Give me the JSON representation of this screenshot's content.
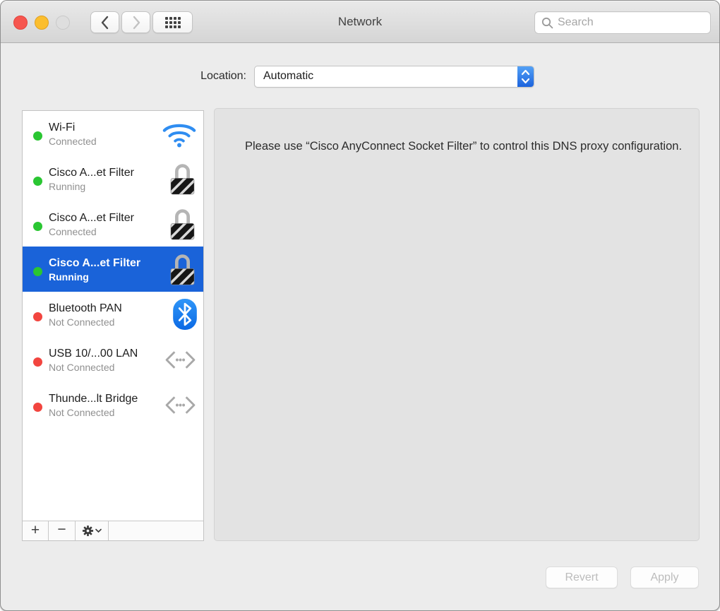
{
  "window": {
    "title": "Network",
    "search_placeholder": "Search"
  },
  "location": {
    "label": "Location:",
    "value": "Automatic"
  },
  "services": [
    {
      "name": "Wi-Fi",
      "status": "Connected",
      "dot": "green",
      "icon": "wifi-icon",
      "selected": false
    },
    {
      "name": "Cisco A...et Filter",
      "status": "Running",
      "dot": "green",
      "icon": "lock-icon",
      "selected": false
    },
    {
      "name": "Cisco A...et Filter",
      "status": "Connected",
      "dot": "green",
      "icon": "lock-icon",
      "selected": false
    },
    {
      "name": "Cisco A...et Filter",
      "status": "Running",
      "dot": "green",
      "icon": "lock-icon",
      "selected": true
    },
    {
      "name": "Bluetooth PAN",
      "status": "Not Connected",
      "dot": "red",
      "icon": "bluetooth-icon",
      "selected": false
    },
    {
      "name": "USB 10/...00 LAN",
      "status": "Not Connected",
      "dot": "red",
      "icon": "ethernet-icon",
      "selected": false
    },
    {
      "name": "Thunde...lt Bridge",
      "status": "Not Connected",
      "dot": "red",
      "icon": "ethernet-icon",
      "selected": false
    }
  ],
  "sidebar_actions": {
    "add_label": "+",
    "remove_label": "−"
  },
  "main_panel": {
    "message": "Please use “Cisco AnyConnect Socket Filter” to control this DNS proxy configuration."
  },
  "footer": {
    "revert_label": "Revert",
    "apply_label": "Apply"
  },
  "colors": {
    "selection_blue": "#1a63d9",
    "status_green": "#2ac632",
    "status_red": "#f2453f",
    "stepper_blue": "#1c63dd",
    "panel_grey": "#e3e3e3"
  }
}
